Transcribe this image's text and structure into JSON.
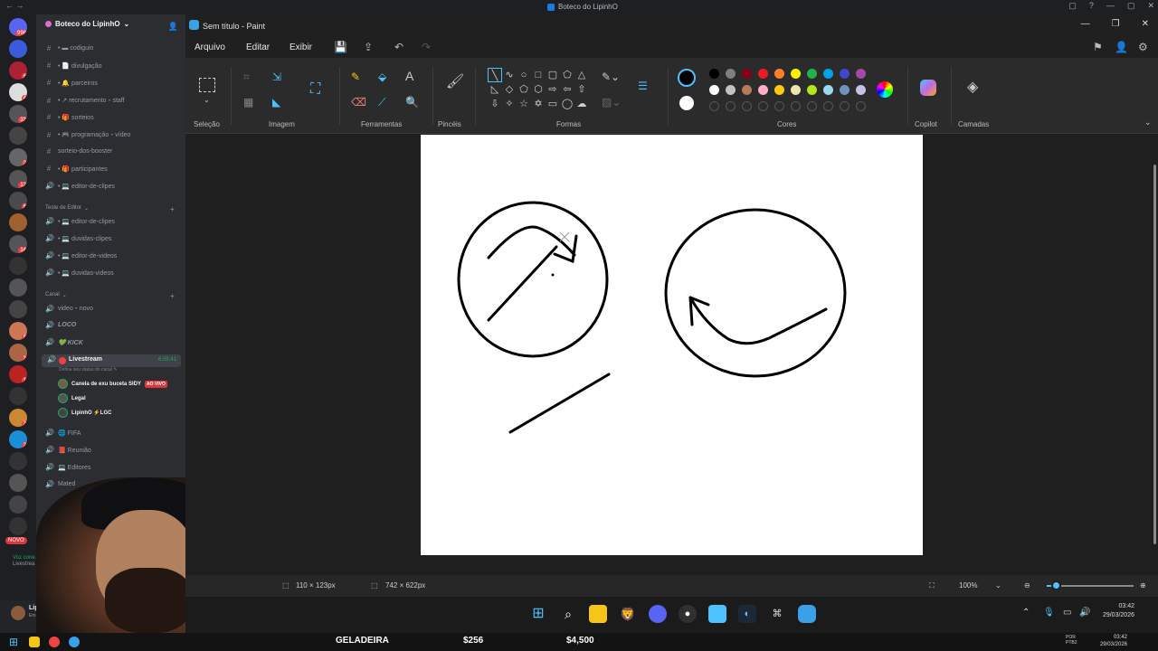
{
  "window": {
    "title": "Boteco do LipinhO",
    "nav": "← →",
    "controls": [
      "▢",
      "?",
      "—",
      "▢",
      "✕"
    ]
  },
  "servers": {
    "badges": [
      "998",
      "",
      "6",
      "4",
      "33",
      "",
      "2",
      "12",
      "6",
      "",
      "14",
      "",
      "",
      "",
      "6",
      "3",
      "1",
      "",
      "3",
      "2",
      "",
      "",
      "",
      "",
      "NOVO"
    ]
  },
  "sidebar": {
    "guild_name": "Boteco do LipinhO",
    "channels_top": [
      {
        "icon": "#",
        "label": "• ▬ codiguin"
      },
      {
        "icon": "#",
        "label": "• 📄 divulgação"
      },
      {
        "icon": "#",
        "label": "• 🔔 parceiros"
      },
      {
        "icon": "#",
        "label": "• ↗ recrutamento・staff"
      },
      {
        "icon": "#",
        "label": "• 🎁 sorteios"
      },
      {
        "icon": "#",
        "label": "• 🎮 programação・vídeo"
      },
      {
        "icon": "#",
        "label": "sorteio-dos-booster"
      },
      {
        "icon": "#",
        "label": "• 🎁 participantes"
      },
      {
        "icon": "🔊",
        "label": "• 💻 editor-de-clipes"
      }
    ],
    "category_editor": "Teste de Editor",
    "channels_editor": [
      {
        "icon": "🔊",
        "label": "• 💻 editor-de-clipes"
      },
      {
        "icon": "🔊",
        "label": "• 💻 duvidas-clipes"
      },
      {
        "icon": "🔊",
        "label": "• 💻 editor-de-videos"
      },
      {
        "icon": "🔊",
        "label": "• 💻 duvidas-videos"
      }
    ],
    "category_canal": "Canal",
    "channels_canal": [
      {
        "icon": "🔊",
        "label": "video・novo"
      },
      {
        "icon": "🔊",
        "label": "LOCO"
      },
      {
        "icon": "🔊",
        "label": "💚 KICK"
      }
    ],
    "live_channel": {
      "label": "Livestream",
      "time": "6:59:41",
      "status_hint": "Defina seu status do canal ✎"
    },
    "voice_users": [
      {
        "name": "Canela de exu buceta SIDY",
        "badge": "AO VIVO"
      },
      {
        "name": "Legal",
        "badge": ""
      },
      {
        "name": "LipinhO ⚡LGC",
        "badge": ""
      }
    ],
    "channels_bottom": [
      {
        "icon": "🔊",
        "label": "🌐 FIFA"
      },
      {
        "icon": "🔊",
        "label": "📕 Reunião"
      },
      {
        "icon": "🔊",
        "label": "💻 Editores"
      },
      {
        "icon": "🔊",
        "label": "Mated"
      }
    ],
    "voice_status": "Voz cone..ta",
    "voice_sub": "Livestrea",
    "user_name": "LipinhO",
    "user_status": "Em voz"
  },
  "paint": {
    "title": "Sem título - Paint",
    "menu": [
      "Arquivo",
      "Editar",
      "Exibir"
    ],
    "groups": [
      "Seleção",
      "Imagem",
      "Ferramentas",
      "Pincéis",
      "Formas",
      "Cores",
      "Copilot",
      "Camadas"
    ],
    "status_selection": "110 × 123px",
    "status_canvas": "742 × 622px",
    "zoom": "100%",
    "zoom_fraction": 0.1,
    "palette_row1": [
      "#000000",
      "#7f7f7f",
      "#880015",
      "#ed1c24",
      "#ff7f27",
      "#fff200",
      "#22b14c",
      "#00a2e8",
      "#3f48cc",
      "#a349a4"
    ],
    "palette_row2": [
      "#ffffff",
      "#c3c3c3",
      "#b97a57",
      "#ffaec9",
      "#ffc90e",
      "#efe4b0",
      "#b5e61d",
      "#99d9ea",
      "#7092be",
      "#c8bfe7"
    ],
    "primary_color": "#000000",
    "secondary_color": "#ffffff"
  },
  "taskbar": {
    "time": "03:42",
    "date": "29/03/2026",
    "lang": "POR",
    "lang2": "PTB2"
  },
  "stream_bar": {
    "label": "GELADEIRA",
    "value1": "$256",
    "value2": "$4,500",
    "time": "03:42",
    "date": "29/03/2026"
  }
}
